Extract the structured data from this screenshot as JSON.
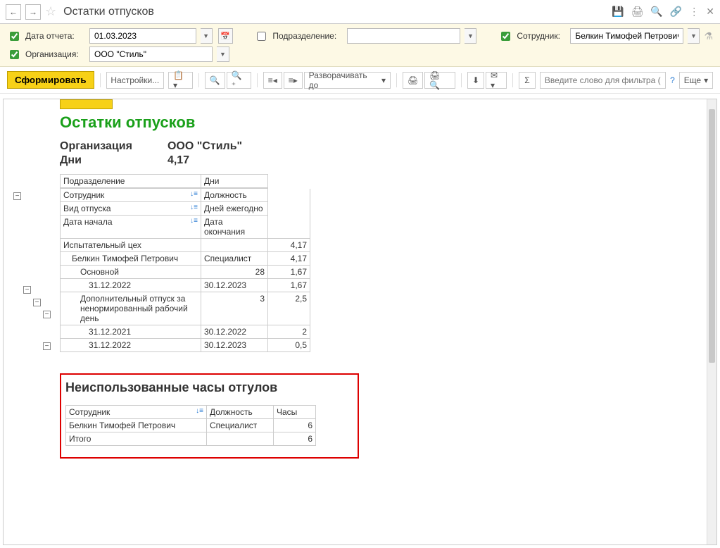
{
  "title": "Остатки отпусков",
  "filters": {
    "reportDate": {
      "label": "Дата отчета:",
      "value": "01.03.2023",
      "checked": true
    },
    "dept": {
      "label": "Подразделение:",
      "value": "",
      "checked": false
    },
    "emp": {
      "label": "Сотрудник:",
      "value": "Белкин Тимофей Петрович",
      "checked": true
    },
    "org": {
      "label": "Организация:",
      "value": "ООО \"Стиль\"",
      "checked": true
    }
  },
  "toolbar": {
    "generate": "Сформировать",
    "settings": "Настройки...",
    "expandTo": "Разворачивать до",
    "filterPlaceholder": "Введите слово для фильтра (н...",
    "more": "Еще"
  },
  "report": {
    "title": "Остатки отпусков",
    "orgLabel": "Организация",
    "orgVal": "ООО \"Стиль\"",
    "daysLabel": "Дни",
    "daysVal": "4,17",
    "headers": {
      "dept": "Подразделение",
      "emp": "Сотрудник",
      "type": "Вид отпуска",
      "startDate": "Дата начала",
      "position": "Должность",
      "yearlyDays": "Дней ежегодно",
      "endDate": "Дата окончания",
      "days": "Дни"
    },
    "rows": [
      {
        "lvl": 0,
        "c1": "Испытательный цех",
        "c2": "",
        "c3": "4,17"
      },
      {
        "lvl": 1,
        "c1": "Белкин Тимофей Петрович",
        "c2": "Специалист",
        "c3": "4,17"
      },
      {
        "lvl": 2,
        "c1": "Основной",
        "c2n": "28",
        "c3": "1,67"
      },
      {
        "lvl": 3,
        "c1": "31.12.2022",
        "c2": "30.12.2023",
        "c3": "1,67"
      },
      {
        "lvl": 2,
        "c1": "Дополнительный отпуск за ненормированный рабочий день",
        "c2n": "3",
        "c3": "2,5"
      },
      {
        "lvl": 3,
        "c1": "31.12.2021",
        "c2": "30.12.2022",
        "c3": "2"
      },
      {
        "lvl": 3,
        "c1": "31.12.2022",
        "c2": "30.12.2023",
        "c3": "0,5"
      }
    ]
  },
  "section2": {
    "title": "Неиспользованные часы отгулов",
    "headers": {
      "emp": "Сотрудник",
      "position": "Должность",
      "hours": "Часы"
    },
    "rows": [
      {
        "emp": "Белкин Тимофей Петрович",
        "pos": "Специалист",
        "hrs": "6"
      }
    ],
    "totalLabel": "Итого",
    "totalVal": "6"
  }
}
